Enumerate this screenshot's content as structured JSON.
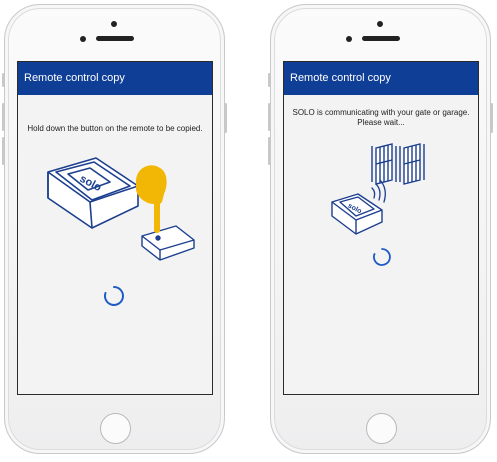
{
  "screens": [
    {
      "header_title": "Remote control copy",
      "message": "Hold down the button on the remote to be copied.",
      "device_label": "solo"
    },
    {
      "header_title": "Remote control copy",
      "message": "SOLO is communicating with your gate or garage. Please wait...",
      "device_label": "solo"
    }
  ],
  "colors": {
    "header": "#0f3e96",
    "spinner": "#1e5bc6",
    "finger": "#f2b705",
    "illustration_stroke": "#1c3f8f"
  },
  "icons": [
    "solo-device-icon",
    "remote-control-icon",
    "finger-press-icon",
    "gate-icon",
    "signal-waves-icon",
    "loading-spinner-icon"
  ]
}
